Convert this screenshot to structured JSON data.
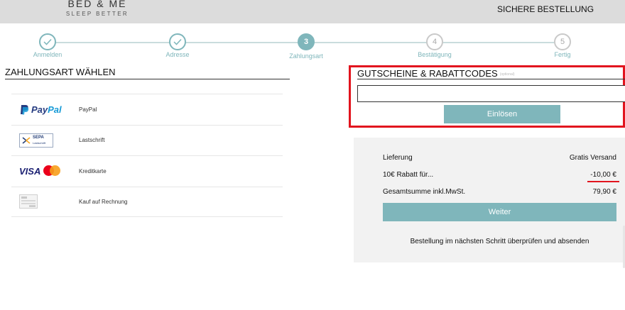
{
  "header": {
    "brand_name": "BED & ME",
    "brand_tagline": "SLEEP BETTER",
    "secure_checkout": "SICHERE BESTELLUNG"
  },
  "steps": [
    {
      "number": "",
      "label": "Anmelden",
      "state": "done"
    },
    {
      "number": "",
      "label": "Adresse",
      "state": "done"
    },
    {
      "number": "3",
      "label": "Zahlungsart",
      "state": "active"
    },
    {
      "number": "4",
      "label": "Bestätigung",
      "state": "todo"
    },
    {
      "number": "5",
      "label": "Fertig",
      "state": "todo"
    }
  ],
  "payment": {
    "title": "ZAHLUNGSART WÄHLEN",
    "methods": [
      {
        "name": "PayPal",
        "icon": "paypal-logo"
      },
      {
        "name": "Lastschrift",
        "icon": "sepa-logo"
      },
      {
        "name": "Kreditkarte",
        "icon": "visa-mastercard-logo"
      },
      {
        "name": "Kauf auf Rechnung",
        "icon": "invoice-icon"
      }
    ],
    "logo_text": {
      "paypal_pay": "Pay",
      "paypal_pal": "Pal",
      "sepa": "SEPA",
      "sepa_sub": "Lastschrift",
      "visa": "VISA"
    }
  },
  "voucher": {
    "title": "GUTSCHEINE & RABATTCODES",
    "optional_note": "(optional)",
    "input_value": "",
    "redeem_label": "Einlösen"
  },
  "summary": {
    "shipping_label": "Lieferung",
    "shipping_value": "Gratis Versand",
    "discount_label": "10€ Rabatt für...",
    "discount_value": "-10,00 €",
    "total_label": "Gesamtsumme inkl.MwSt.",
    "total_value": "79,90 €",
    "next_label": "Weiter",
    "note": "Bestellung im nächsten Schritt überprüfen und absenden"
  },
  "colors": {
    "accent": "#7fb6bb",
    "highlight": "#e2141e",
    "header_bg": "#dcdcdc"
  }
}
